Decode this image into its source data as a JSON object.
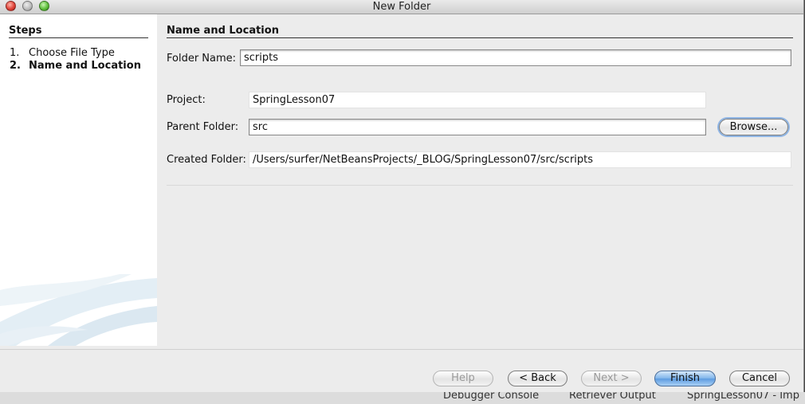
{
  "window": {
    "title": "New Folder"
  },
  "steps": {
    "heading": "Steps",
    "items": [
      {
        "num": "1.",
        "label": "Choose File Type"
      },
      {
        "num": "2.",
        "label": "Name and Location"
      }
    ]
  },
  "main": {
    "section_title": "Name and Location",
    "folder_name": {
      "label": "Folder Name:",
      "value": "scripts"
    },
    "project": {
      "label": "Project:",
      "value": "SpringLesson07"
    },
    "parent_folder": {
      "label": "Parent Folder:",
      "value": "src"
    },
    "browse_label": "Browse...",
    "created_folder": {
      "label": "Created Folder:",
      "value": "/Users/surfer/NetBeansProjects/_BLOG/SpringLesson07/src/scripts"
    }
  },
  "footer": {
    "help": "Help",
    "back": "< Back",
    "next": "Next >",
    "finish": "Finish",
    "cancel": "Cancel"
  },
  "background": {
    "tab_debugger": "Debugger Console",
    "tab_output": "Retriever Output",
    "tab_project": "SpringLesson07 - Imp"
  },
  "colors": {
    "default_button": "#6aa6e6",
    "window_bg": "#ececec"
  }
}
